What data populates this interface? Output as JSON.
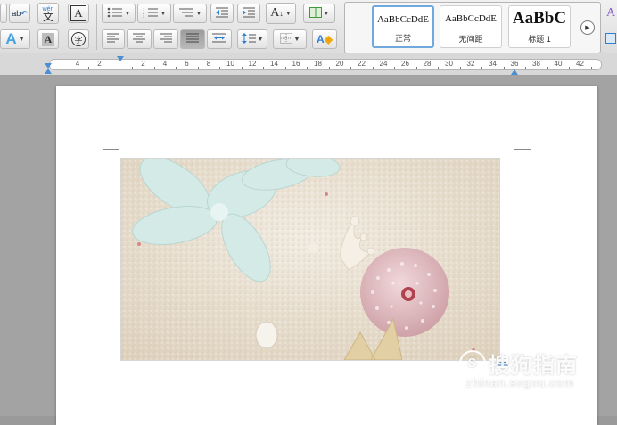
{
  "ribbon": {
    "row1": {
      "phonetic_icon": "abc-phonetic-icon",
      "wen_label": "wén",
      "wen_char": "文",
      "char_border_label": "A",
      "font_color_label": "A",
      "char_shading_label": "A",
      "enclose_char_label": "字"
    },
    "styles": {
      "tiles": [
        {
          "preview": "AaBbCcDdE",
          "name": "正常"
        },
        {
          "preview": "AaBbCcDdE",
          "name": "无间距"
        },
        {
          "preview": "AaBbC",
          "name": "标题 1"
        }
      ]
    }
  },
  "ruler": {
    "numbers": [
      "4",
      "2",
      "2",
      "4",
      "6",
      "8",
      "10",
      "12",
      "14",
      "16",
      "18",
      "20",
      "22",
      "24",
      "26",
      "28",
      "30",
      "32",
      "34",
      "36",
      "38",
      "40",
      "42"
    ]
  },
  "document": {
    "watermark_text": "搜狗指南",
    "watermark_url": "zhinan.sogou.com"
  },
  "colors": {
    "sand": "#e6dccb",
    "petal": "#cfe6e3",
    "urchin": "#e7c3c6",
    "accent_blue": "#2f7fd1"
  }
}
